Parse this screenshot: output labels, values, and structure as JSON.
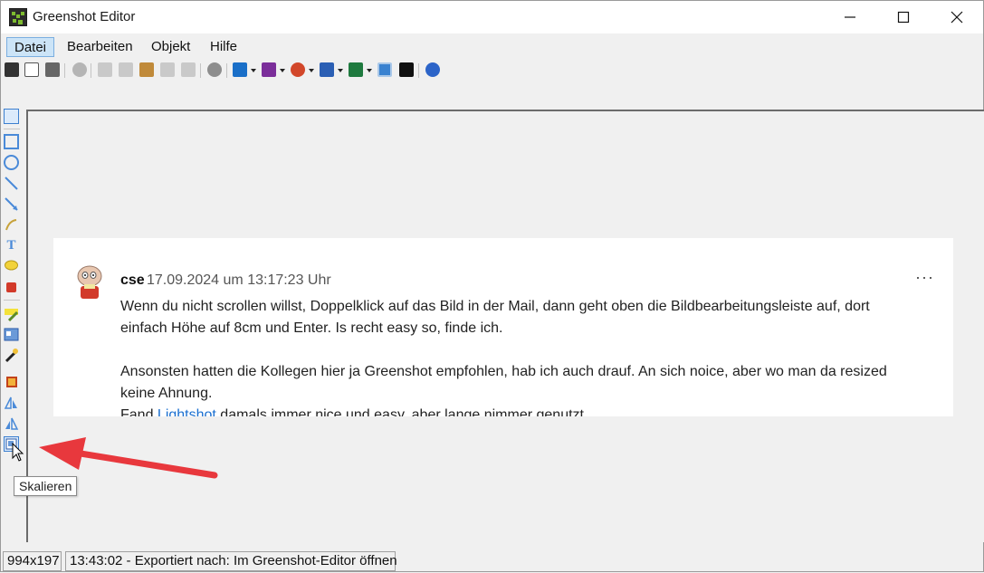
{
  "window": {
    "title": "Greenshot Editor"
  },
  "menu": [
    "Datei",
    "Bearbeiten",
    "Objekt",
    "Hilfe"
  ],
  "toolbar_icons": [
    "save-icon",
    "clipboard-icon",
    "print-icon",
    "delete-icon",
    "cut-icon",
    "copy-icon",
    "paste-icon",
    "undo-icon",
    "redo-icon",
    "settings-icon",
    "outlook-icon",
    "onenote-icon",
    "powerpoint-icon",
    "word-icon",
    "excel-icon",
    "capture-icon",
    "info-icon",
    "help-icon"
  ],
  "left_tools": [
    "select-tool",
    "rectangle-tool",
    "ellipse-tool",
    "line-tool",
    "arrow-tool",
    "freehand-tool",
    "text-tool",
    "speechbubble-tool",
    "counter-tool",
    "highlight-tool",
    "obfuscate-tool",
    "effects-tool",
    "crop-tool",
    "rotate-cw-tool",
    "rotate-ccw-tool",
    "resize-tool"
  ],
  "post": {
    "author": "cse",
    "timestamp": "17.09.2024 um 13:17:23 Uhr",
    "more": "···",
    "line1": "Wenn du nicht scrollen willst, Doppelklick auf das Bild in der Mail, dann geht oben die Bildbearbeitungsleiste auf, dort",
    "line2": "einfach Höhe auf 8cm und Enter. Is recht easy so, finde ich.",
    "line3": "Ansonsten hatten die Kollegen hier ja Greenshot empfohlen, hab ich auch drauf. An sich noice, aber wo man da resized",
    "line4": "keine Ahnung.",
    "line5_prefix": "Fand ",
    "line5_link": "Lightshot",
    "line5_suffix": " damals immer nice und easy, aber lange nimmer genutzt"
  },
  "tooltip": "Skalieren",
  "status": {
    "size": "994x197",
    "message": "13:43:02 - Exportiert nach: Im Greenshot-Editor öffnen"
  },
  "colors": {
    "accent": "#cce4f7",
    "arrow": "#e8383d",
    "link": "#1a6fd0"
  }
}
